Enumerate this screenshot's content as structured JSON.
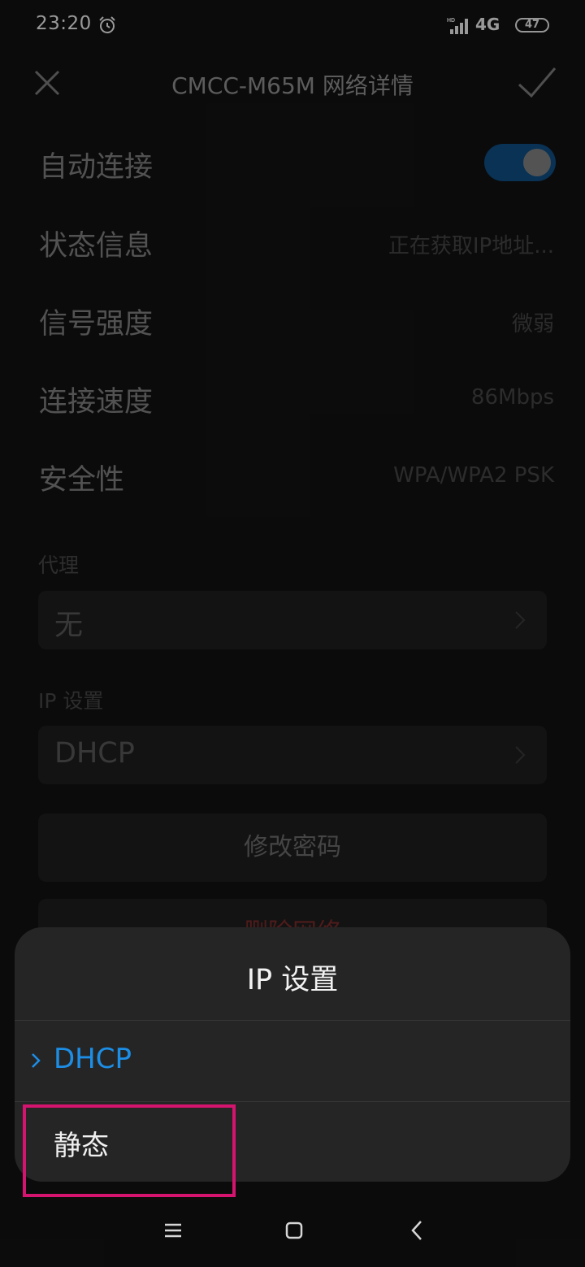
{
  "status_bar": {
    "time": "23:20",
    "network": "4G",
    "battery": "47"
  },
  "title_bar": {
    "title": "CMCC-M65M 网络详情"
  },
  "settings": {
    "auto_connect": {
      "label": "自动连接",
      "enabled": true
    },
    "status": {
      "label": "状态信息",
      "value": "正在获取IP地址..."
    },
    "signal": {
      "label": "信号强度",
      "value": "微弱"
    },
    "speed": {
      "label": "连接速度",
      "value": "86Mbps"
    },
    "security": {
      "label": "安全性",
      "value": "WPA/WPA2 PSK"
    },
    "proxy": {
      "label": "代理",
      "value": "无"
    },
    "ip_settings": {
      "label": "IP 设置",
      "value": "DHCP"
    },
    "change_password": "修改密码",
    "delete_network": "删除网络"
  },
  "sheet": {
    "title": "IP 设置",
    "options": [
      {
        "label": "DHCP",
        "selected": true
      },
      {
        "label": "静态",
        "selected": false
      }
    ]
  },
  "colors": {
    "accent": "#1d8ee6",
    "toggle_on": "#0f4e82",
    "highlight": "#d4146e",
    "danger": "#7a2a2a"
  },
  "icons": {
    "close": "close-icon",
    "confirm": "check-icon",
    "menu": "menu-icon",
    "home": "home-icon",
    "back": "back-icon"
  }
}
